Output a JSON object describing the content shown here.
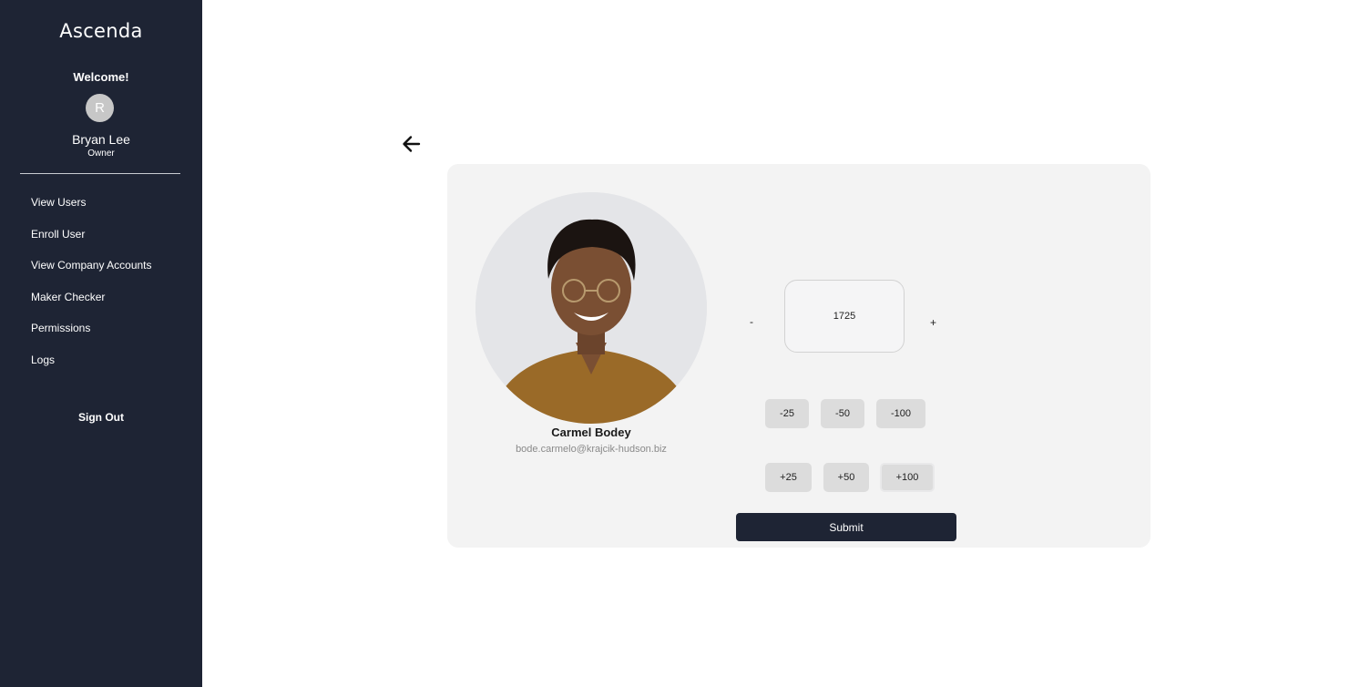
{
  "sidebar": {
    "logo": "Ascenda",
    "welcome": "Welcome!",
    "avatar_initial": "R",
    "user_name": "Bryan Lee",
    "user_role": "Owner",
    "nav_items": [
      {
        "label": "View Users"
      },
      {
        "label": "Enroll User"
      },
      {
        "label": "View Company Accounts"
      },
      {
        "label": "Maker Checker"
      },
      {
        "label": "Permissions"
      },
      {
        "label": "Logs"
      }
    ],
    "sign_out": "Sign Out"
  },
  "back_icon": "arrow-left-icon",
  "profile": {
    "name": "Carmel Bodey",
    "email": "bode.carmelo@krajcik-hudson.biz"
  },
  "points": {
    "decrement_label": "-",
    "increment_label": "+",
    "value": "1725",
    "decrease_options": [
      "-25",
      "-50",
      "-100"
    ],
    "increase_options": [
      "+25",
      "+50",
      "+100"
    ]
  },
  "submit_label": "Submit",
  "colors": {
    "sidebar_bg": "#1e2434",
    "card_bg": "#f3f3f3",
    "button_bg": "#dcdcdc",
    "primary": "#1e2434"
  }
}
